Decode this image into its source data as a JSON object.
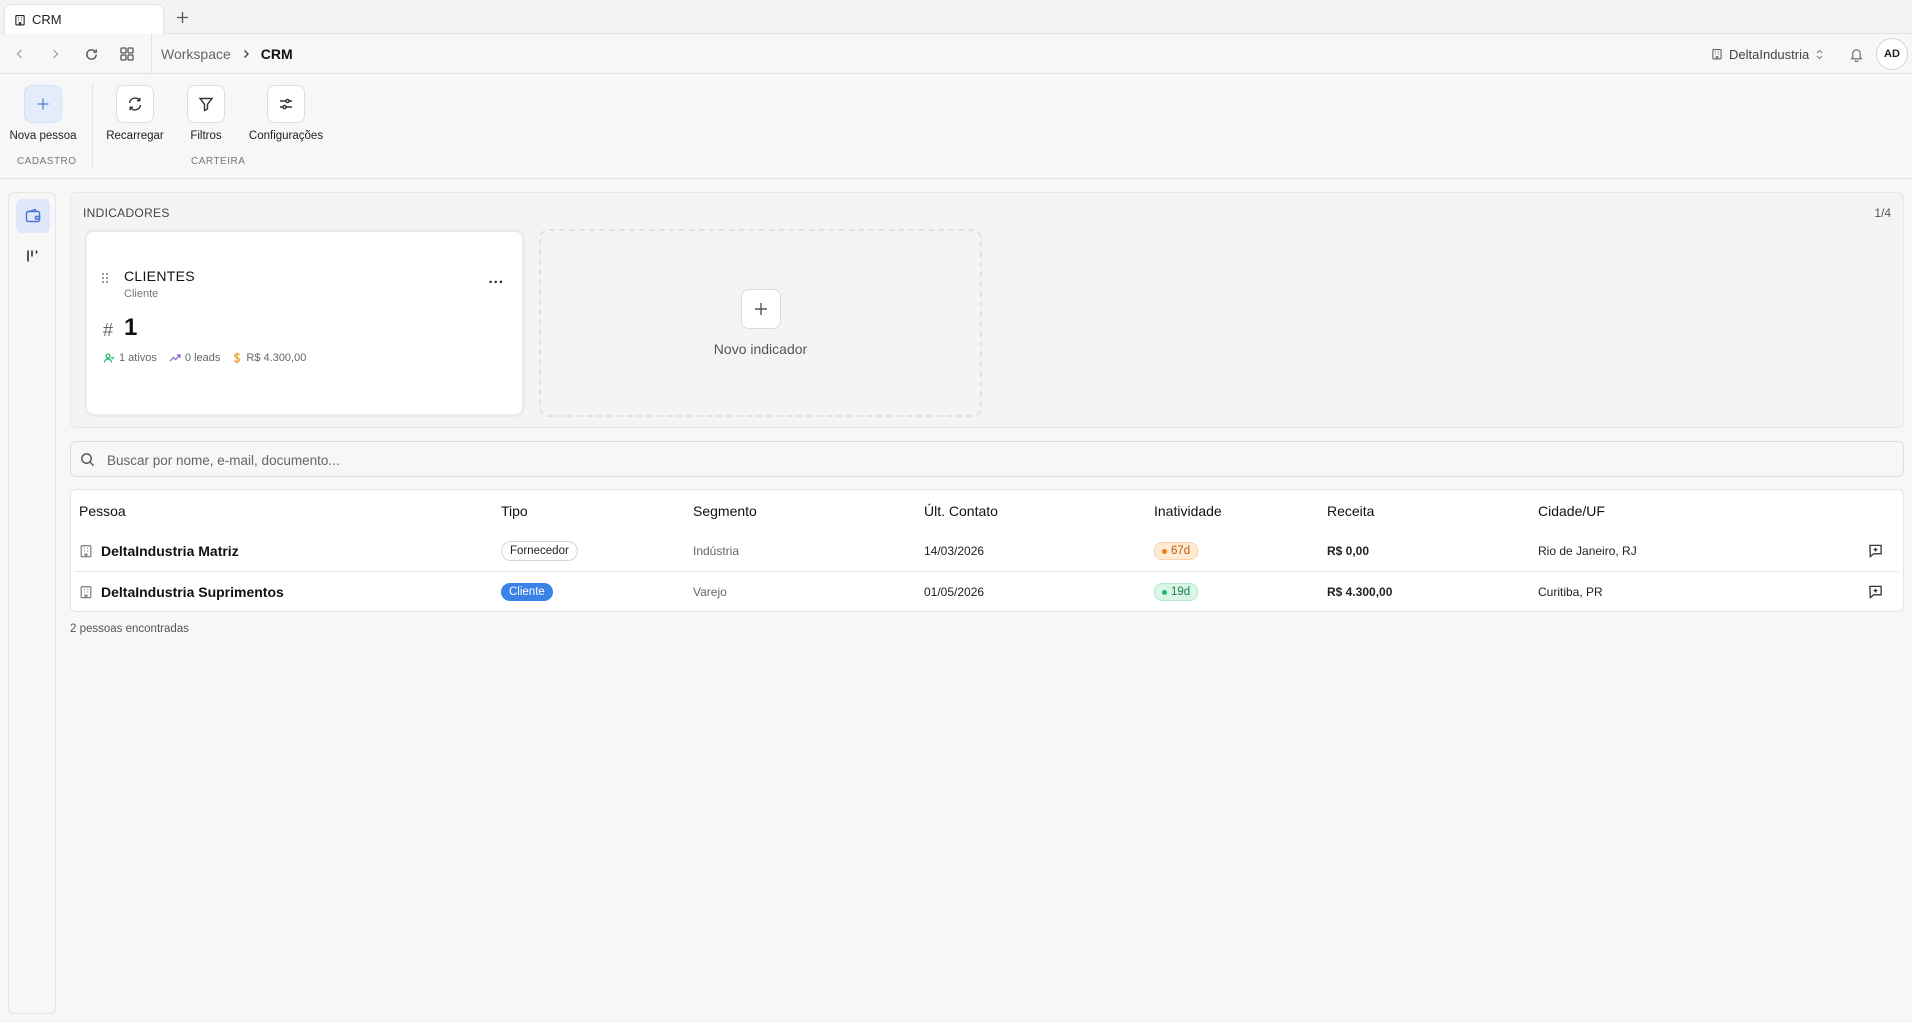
{
  "tab": {
    "title": "CRM",
    "icon": "building-icon"
  },
  "breadcrumb": {
    "workspace": "Workspace",
    "current": "CRM"
  },
  "workspace_selector": {
    "label": "DeltaIndustria"
  },
  "user": {
    "initials": "AD"
  },
  "ribbon": {
    "new_person": "Nova pessoa",
    "reload": "Recarregar",
    "filters": "Filtros",
    "settings": "Configurações",
    "group_cadastro": "CADASTRO",
    "group_carteira": "CARTEIRA"
  },
  "indicators": {
    "title": "INDICADORES",
    "page": "1/4",
    "card": {
      "title": "CLIENTES",
      "subtitle": "Cliente",
      "more": "...",
      "hash": "#",
      "value": "1",
      "active": "1 ativos",
      "leads": "0 leads",
      "revenue": "R$ 4.300,00"
    },
    "new_label": "Novo indicador"
  },
  "search": {
    "placeholder": "Buscar por nome, e-mail, documento..."
  },
  "table": {
    "headers": [
      "Pessoa",
      "Tipo",
      "Segmento",
      "Últ. Contato",
      "Inatividade",
      "Receita",
      "Cidade/UF"
    ],
    "rows": [
      {
        "name": "DeltaIndustria Matriz",
        "type": "Fornecedor",
        "segment": "Indústria",
        "last_contact": "14/03/2026",
        "inactivity": "67d",
        "inactivity_status": "warning",
        "revenue": "R$ 0,00",
        "city": "Rio de Janeiro, RJ"
      },
      {
        "name": "DeltaIndustria Suprimentos",
        "type": "Cliente",
        "segment": "Varejo",
        "last_contact": "01/05/2026",
        "inactivity": "19d",
        "inactivity_status": "ok",
        "revenue": "R$ 4.300,00",
        "city": "Curitiba, PR"
      }
    ]
  },
  "result_count": "2 pessoas encontradas",
  "colors": {
    "accent": "#3b82e6",
    "warning": "#f07c12",
    "ok": "#1eb86a"
  }
}
